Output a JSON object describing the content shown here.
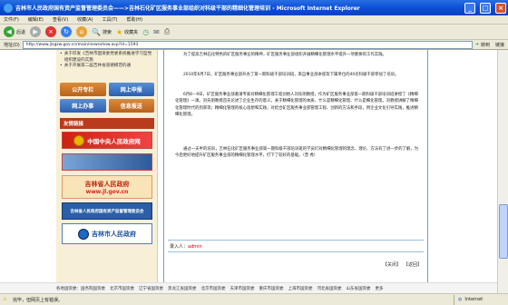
{
  "window": {
    "title": "吉林市人民政府国有资产监督管理委员会——>吉林石化矿区服务事业部组织对科级干部的精细化管理培训 - Microsoft Internet Explorer"
  },
  "menu": [
    "文件(F)",
    "编辑(E)",
    "查看(V)",
    "收藏(A)",
    "工具(T)",
    "帮助(H)"
  ],
  "toolbar": {
    "back": "后退",
    "search": "搜索",
    "favorites": "收藏夹"
  },
  "address": {
    "label": "地址(D)",
    "url": "http://www.jlsgzw.gov.cn/main/newsshow.asp?id=1593",
    "go": "转到",
    "links": "链接"
  },
  "sidebar": {
    "news": [
      "关于印发《吉林市国资委党委系统推进学习型党组织建设的实施",
      "关于开展第二届吉林省道德模范的通"
    ],
    "quick": [
      "公开专栏",
      "网上申报",
      "网上办事",
      "信息报送"
    ],
    "friends_title": "友情链接",
    "banners": [
      "中国中央人民政府网",
      "吉林省人民政府",
      "www.jl.gov.cn",
      "吉林省人民政府国有资产监督管理委员会",
      "吉林市人民政府"
    ]
  },
  "article": {
    "p1": "为了提高吉林石化特色的矿区服务事业的精神，矿区服务事业部组织开展精细化管理水平提升一项重要的工作实践。",
    "p2": "2010年6月7日，矿区服务事业部开办了第一期科级干部培训班，来自事业部本部及下属单位的40名科级干部参加了培训。",
    "p3": "6月8—9日，矿区服务事业部邀请专家对精细化管理工程创始人刘先明教授，作为矿区服务事业部第一期科级干部培训班讲授了《精细化管理》一课。刘先明教授首先论述了企业生存的意义，关于精细化管理的本质、什么是精细化管理、什么是细化管理。刘教授讲解了精细化管理时代的到来等；精细化管理的核心思想和实践，对结合矿区服务事业部管理工程、创新的方法和手段，用企业文化引导实践，推进精细化管理。",
    "p4": "通过一天半的培训，吉林石化矿区服务事业部第一期科级干部培训班的学员们对精细化管理的理念、理论、方法有了进一步的了解，为今后更好地提升矿区服务事业部的精细化管理水平，打下了较好的基础。（曾 秀）",
    "entry_label": "录入人：",
    "entry_name": "admin",
    "close": "关闭",
    "back": "返回"
  },
  "bottom_links": [
    "各地国资委：国务院国资委",
    "北京市国资委",
    "辽宁省国资委",
    "黑龙江省国资委",
    "北京市国资委",
    "天津市国资委",
    "重庆市国资委",
    "上海市国资委",
    "河北省国资委",
    "山东省国资委",
    "更多"
  ],
  "status": {
    "text": "完毕，但网页上有错误。",
    "zone": "Internet"
  }
}
